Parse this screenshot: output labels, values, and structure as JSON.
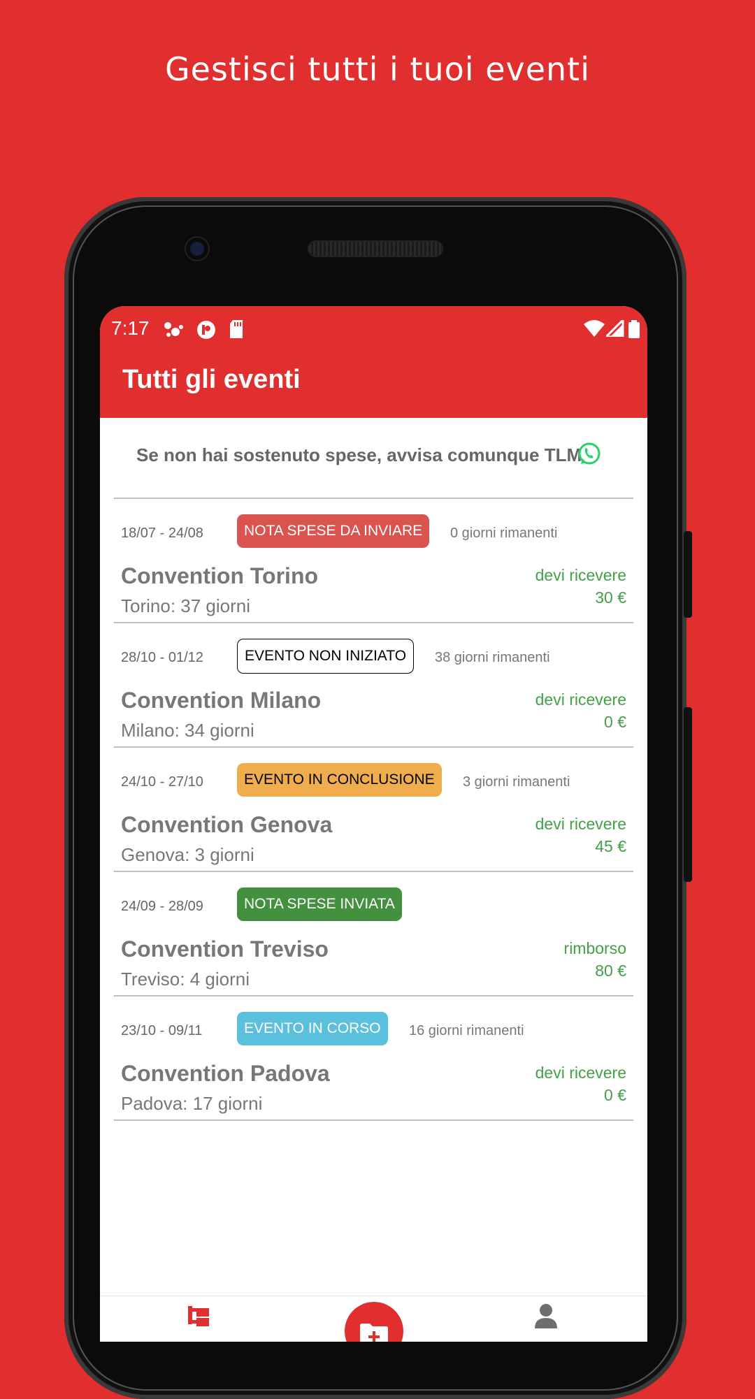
{
  "headline": "Gestisci tutti i tuoi eventi",
  "status_bar": {
    "time": "7:17"
  },
  "app_title": "Tutti gli eventi",
  "notice": {
    "text": "Se non hai sostenuto spese, avvisa comunque TLM",
    "icon": "whatsapp-icon"
  },
  "events": [
    {
      "dates": "18/07 - 24/08",
      "badge": "NOTA SPESE DA INVIARE",
      "badge_bg": "#D9534F",
      "badge_fg": "#ffffff",
      "badge_border": "none",
      "remaining": "0 giorni rimanenti",
      "name": "Convention Torino",
      "location": "Torino: 37 giorni",
      "kind": "devi ricevere",
      "amount": "30 €"
    },
    {
      "dates": "28/10 - 01/12",
      "badge": "EVENTO NON INIZIATO",
      "badge_bg": "#ffffff",
      "badge_fg": "#000000",
      "badge_border": "1.5px solid #000",
      "remaining": "38 giorni rimanenti",
      "name": "Convention Milano",
      "location": "Milano: 34 giorni",
      "kind": "devi ricevere",
      "amount": "0 €"
    },
    {
      "dates": "24/10 - 27/10",
      "badge": "EVENTO IN CONCLUSIONE",
      "badge_bg": "#F0AD4E",
      "badge_fg": "#000000",
      "badge_border": "none",
      "remaining": "3 giorni rimanenti",
      "name": "Convention Genova",
      "location": "Genova: 3 giorni",
      "kind": "devi ricevere",
      "amount": "45 €"
    },
    {
      "dates": "24/09 - 28/09",
      "badge": "NOTA SPESE INVIATA",
      "badge_bg": "#43913F",
      "badge_fg": "#ffffff",
      "badge_border": "none",
      "remaining": "",
      "name": "Convention Treviso",
      "location": "Treviso: 4 giorni",
      "kind": "rimborso",
      "amount": "80 €"
    },
    {
      "dates": "23/10 - 09/11",
      "badge": "EVENTO IN CORSO",
      "badge_bg": "#5BC0DE",
      "badge_fg": "#ffffff",
      "badge_border": "none",
      "remaining": "16 giorni rimanenti",
      "name": "Convention Padova",
      "location": "Padova: 17 giorni",
      "kind": "devi ricevere",
      "amount": "0 €"
    }
  ],
  "bottom_nav": [
    {
      "name": "events-tab",
      "icon": "events-icon"
    },
    {
      "name": "add-event-button",
      "icon": "folder-plus-icon"
    },
    {
      "name": "profile-tab",
      "icon": "person-icon"
    }
  ],
  "colors": {
    "brand_red": "#E12E2E",
    "money_green": "#43A047"
  }
}
